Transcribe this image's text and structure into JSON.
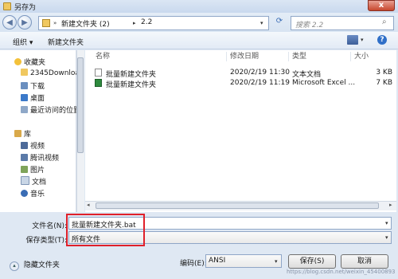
{
  "window": {
    "title": "另存为",
    "close_glyph": "x"
  },
  "address_bar": {
    "crumbs": [
      "新建文件夹 (2)",
      "2.2"
    ],
    "search_placeholder": "搜索 2.2"
  },
  "toolbar": {
    "organize_label": "组织 ▾",
    "new_folder_label": "新建文件夹"
  },
  "nav_pane": {
    "favorites_label": "收藏夹",
    "favorites": [
      "2345Download",
      "下载",
      "桌面",
      "最近访问的位置"
    ],
    "library_label": "库",
    "libraries": [
      "视频",
      "腾讯视频",
      "图片",
      "文档",
      "音乐"
    ]
  },
  "columns": {
    "name": "名称",
    "date": "修改日期",
    "type": "类型",
    "size": "大小"
  },
  "files": [
    {
      "name": "批量新建文件夹",
      "date": "2020/2/19 11:30",
      "type": "文本文档",
      "size": "3 KB"
    },
    {
      "name": "批量新建文件夹",
      "date": "2020/2/19 11:19",
      "type": "Microsoft Excel ...",
      "size": "7 KB"
    }
  ],
  "form": {
    "filename_label": "文件名(N):",
    "filename_value": "批量新建文件夹.bat",
    "savetype_label": "保存类型(T):",
    "savetype_value": "所有文件",
    "encoding_label": "编码(E):",
    "encoding_value": "ANSI"
  },
  "buttons": {
    "hide_folders": "隐藏文件夹",
    "save": "保存(S)",
    "cancel": "取消"
  },
  "watermark": "https://blog.csdn.net/weixin_45400893",
  "colors": {
    "highlight_box": "#e0202a",
    "window_bg": "#dfe8f3"
  }
}
